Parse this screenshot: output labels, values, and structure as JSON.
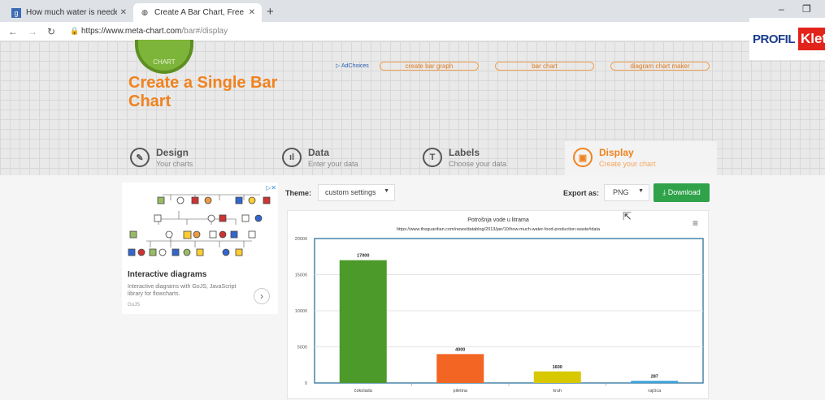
{
  "browser": {
    "tabs": [
      {
        "title": "How much water is needed to pr",
        "icon": "meta-icon"
      },
      {
        "title": "Create A Bar Chart, Free . Custom",
        "icon": "globe-icon"
      }
    ],
    "url_host": "https://www.meta-chart.com",
    "url_path": "/bar#/display"
  },
  "overlay_logo": {
    "part1": "PROFIL",
    "part2": "Klett"
  },
  "site": {
    "title": "Create a Single Bar Chart",
    "logo_text": "CHART",
    "adchoices": "AdChoices",
    "ad_links": [
      "create bar graph",
      "bar chart",
      "diagram chart maker"
    ]
  },
  "steps": [
    {
      "label": "Design",
      "sub": "Your charts",
      "icon": "palette-icon"
    },
    {
      "label": "Data",
      "sub": "Enter your data",
      "icon": "bar-chart-icon"
    },
    {
      "label": "Labels",
      "sub": "Choose your data",
      "icon": "text-icon"
    },
    {
      "label": "Display",
      "sub": "Create your chart",
      "icon": "display-icon",
      "active": true
    }
  ],
  "ad": {
    "title": "Interactive diagrams",
    "desc": "Interactive diagrams with GoJS, JavaScript library for flowcharts.",
    "source": "GoJS"
  },
  "controls": {
    "theme_label": "Theme:",
    "theme_value": "custom settings",
    "export_label": "Export as:",
    "export_value": "PNG",
    "download_label": "Download"
  },
  "colors": {
    "accent": "#f0821e",
    "download": "#2fa24a"
  },
  "chart_data": {
    "type": "bar",
    "title": "Potrošnja vode u litrama",
    "subtitle": "https://www.theguardian.com/news/datablog/2013/jan/10/how-much-water-food-production-waste#data",
    "categories": [
      "čokolada",
      "piletina",
      "kruh",
      "rajčica"
    ],
    "values": [
      17000,
      4000,
      1600,
      287
    ],
    "colors": [
      "#4c9a2a",
      "#f26522",
      "#d7c800",
      "#3ba0d8"
    ],
    "y_ticks": [
      0,
      5000,
      10000,
      15000,
      20000
    ],
    "ylim": [
      0,
      20000
    ],
    "grid": true
  }
}
